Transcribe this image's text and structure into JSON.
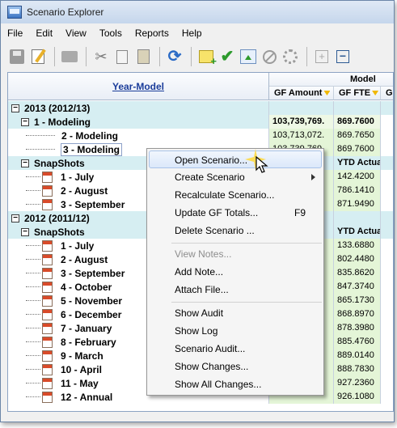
{
  "window": {
    "title": "Scenario Explorer"
  },
  "menubar": {
    "items": [
      "File",
      "Edit",
      "View",
      "Tools",
      "Reports",
      "Help"
    ]
  },
  "grid": {
    "left_header": "Year-Model",
    "group_header": "Model",
    "col_amount": "GF Amount",
    "col_fte": "GF FTE",
    "col_extra": "GF",
    "rows": [
      {
        "kind": "group",
        "label": "2013  (2012/13)",
        "amount": "",
        "fte": ""
      },
      {
        "kind": "model",
        "label": "1 - Modeling",
        "amount": "103,739,769.",
        "fte": "869.7600"
      },
      {
        "kind": "data",
        "label": "2 - Modeling",
        "amount": "103,713,072.",
        "fte": "869.7650"
      },
      {
        "kind": "data",
        "label": "3 - Modeling",
        "amount": "103,739,769.",
        "fte": "869.7600"
      },
      {
        "kind": "group",
        "label": "SnapShots",
        "amount": "",
        "fte": "YTD Actual"
      },
      {
        "kind": "data",
        "label": "1 - July",
        "amount": "",
        "fte": "142.4200"
      },
      {
        "kind": "data",
        "label": "2 - August",
        "amount": "",
        "fte": "786.1410"
      },
      {
        "kind": "data",
        "label": "3 - September",
        "amount": "",
        "fte": "871.9490"
      },
      {
        "kind": "group",
        "label": "2012  (2011/12)",
        "amount": "",
        "fte": ""
      },
      {
        "kind": "group",
        "label": "SnapShots",
        "amount": "",
        "fte": "YTD Actual"
      },
      {
        "kind": "data",
        "label": "1 - July",
        "amount": "",
        "fte": "133.6880"
      },
      {
        "kind": "data",
        "label": "2 - August",
        "amount": "",
        "fte": "802.4480"
      },
      {
        "kind": "data",
        "label": "3 - September",
        "amount": "",
        "fte": "835.8620"
      },
      {
        "kind": "data",
        "label": "4 - October",
        "amount": "",
        "fte": "847.3740"
      },
      {
        "kind": "data",
        "label": "5 - November",
        "amount": "",
        "fte": "865.1730"
      },
      {
        "kind": "data",
        "label": "6 - December",
        "amount": "",
        "fte": "868.8970"
      },
      {
        "kind": "data",
        "label": "7 - January",
        "amount": "",
        "fte": "878.3980"
      },
      {
        "kind": "data",
        "label": "8 - February",
        "amount": "",
        "fte": "885.4760"
      },
      {
        "kind": "data",
        "label": "9 - March",
        "amount": "",
        "fte": "889.0140"
      },
      {
        "kind": "data",
        "label": "10 - April",
        "amount": "",
        "fte": "888.7830"
      },
      {
        "kind": "data",
        "label": "11 - May",
        "amount": "",
        "fte": "927.2360"
      },
      {
        "kind": "data",
        "label": "12 - Annual",
        "amount": "",
        "fte": "926.1080"
      }
    ]
  },
  "context_menu": {
    "items": [
      {
        "label": "Open Scenario...",
        "state": "hot"
      },
      {
        "label": "Create Scenario",
        "submenu": true
      },
      {
        "label": "Recalculate Scenario..."
      },
      {
        "label": "Update GF Totals...",
        "shortcut": "F9"
      },
      {
        "label": "Delete Scenario ..."
      },
      {
        "label": "View Notes...",
        "state": "disabled"
      },
      {
        "label": "Add Note..."
      },
      {
        "label": "Attach File..."
      },
      {
        "label": "Show Audit"
      },
      {
        "label": "Show Log"
      },
      {
        "label": "Scenario Audit..."
      },
      {
        "label": "Show Changes..."
      },
      {
        "label": "Show All Changes..."
      }
    ]
  }
}
